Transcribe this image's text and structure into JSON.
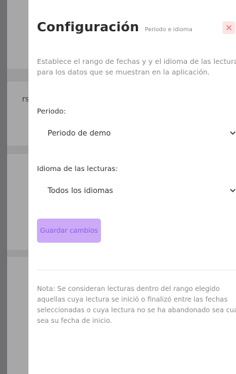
{
  "background": {
    "partial_text": "rsc"
  },
  "panel": {
    "title": "Configuración",
    "subtitle": "Periodo e idioma",
    "close_icon": "close-icon",
    "description": "Establece el rango de fechas y y el idioma de las lecturas para los datos que se muestran en la aplicación.",
    "period": {
      "label": "Periodo:",
      "selected": "Periodo de demo"
    },
    "language": {
      "label": "Idioma de las lecturas:",
      "selected": "Todos los idiomas"
    },
    "save_label": "Guardar cambios",
    "note": "Nota: Se consideran lecturas dentro del rango elegido aquellas cuya lectura se inició o finalizó entre las fechas seleccionadas o cuya lectura no se ha abandonado sea cual sea su fecha de inicio."
  },
  "colors": {
    "accent_bg": "#cdaaf7",
    "accent_text": "#8e5ae8",
    "close_bg": "#fbe5e5",
    "close_icon": "#e06b6b"
  }
}
